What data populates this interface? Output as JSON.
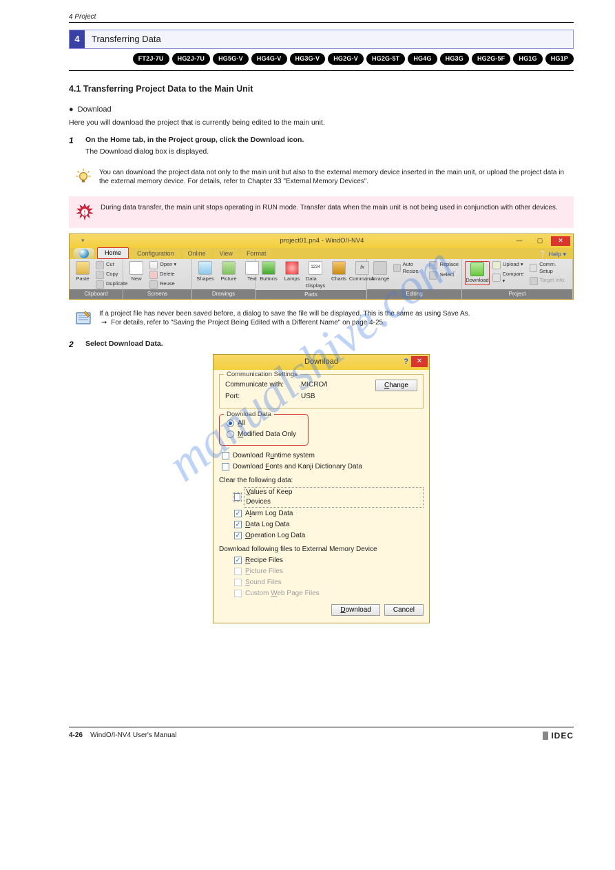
{
  "header": {
    "chapter_ref": "4   Project",
    "breadcrumb": ""
  },
  "section": {
    "number": "4",
    "title": "Transferring Data"
  },
  "models": [
    "FT2J-7U",
    "HG2J-7U",
    "HG5G-V",
    "HG4G-V",
    "HG3G-V",
    "HG2G-V",
    "HG2G-5T",
    "HG4G",
    "HG3G",
    "HG2G-5F",
    "HG1G",
    "HG1P"
  ],
  "subheading_4_1": "4.1   Transferring Project Data to the Main Unit",
  "subsub": {
    "lead": "●",
    "text": "Download"
  },
  "desc": "Here you will download the project that is currently being edited to the main unit.",
  "steps": [
    {
      "num": "1",
      "bold": "On the Home tab, in the Project group, click the Download icon.",
      "after": "The Download dialog box is displayed."
    },
    {
      "num": "2",
      "bold": "Select Download Data."
    }
  ],
  "tip": {
    "text_1": "You can download the project data not only to the main unit but also to the external memory device inserted in the main unit, or upload the project data in the external memory device. For details, refer to Chapter 33 \"External Memory Devices\"."
  },
  "warn": {
    "text": "During data transfer, the main unit stops operating in RUN mode. Transfer data when the main unit is not being used in conjunction with other devices."
  },
  "note": {
    "text_1": "If a project file has never been saved before, a dialog to save the file will be displayed. This is the same as using Save As.",
    "text_2": "For details, refer to \"Saving the Project Being Edited with a Different Name\" on page 4-25."
  },
  "ribbon": {
    "window_title": "project01.pn4 - WindO/I-NV4",
    "help": "❔ Help ▾",
    "tabs": [
      "Home",
      "Configuration",
      "Online",
      "View",
      "Format"
    ],
    "groups": {
      "clipboard": {
        "label": "Clipboard",
        "paste": "Paste",
        "cut": "Cut",
        "copy": "Copy",
        "dup": "Duplicate"
      },
      "screens": {
        "label": "Screens",
        "new": "New",
        "open": "Open ▾",
        "delete": "Delete",
        "reuse": "Reuse"
      },
      "drawings": {
        "label": "Drawings",
        "shapes": "Shapes",
        "picture": "Picture",
        "text": "Text"
      },
      "parts": {
        "label": "Parts",
        "buttons": "Buttons",
        "lamps": "Lamps",
        "data": "Data\nDisplays",
        "charts": "Charts",
        "commands": "Commands"
      },
      "editing": {
        "label": "Editing",
        "arrange": "Arrange",
        "autoresize": "Auto Resize",
        "select": "Select",
        "replace": "Replace"
      },
      "project": {
        "label": "Project",
        "download": "Download",
        "upload": "Upload ▾",
        "compare": "Compare ▾",
        "comm": "Comm. Setup",
        "target": "Target Info."
      }
    }
  },
  "dialog": {
    "title": "Download",
    "comm_legend": "Communication Settings",
    "comm_with_label": "Communicate with:",
    "comm_with_val": "MICRO/I",
    "port_label": "Port:",
    "port_val": "USB",
    "change_btn": "Change",
    "dl_legend": "Download Data",
    "opt_all": "All",
    "opt_modified": "Modified Data Only",
    "chk_runtime": "Download Runtime system",
    "chk_fonts": "Download Fonts and Kanji Dictionary Data",
    "clear_label": "Clear the following data:",
    "chk_keep": "Values of Keep Devices",
    "chk_alarm": "Alarm Log Data",
    "chk_data": "Data Log Data",
    "chk_op": "Operation Log Data",
    "ext_label": "Download following files to External Memory Device",
    "chk_recipe": "Recipe Files",
    "chk_picture": "Picture Files",
    "chk_sound": "Sound Files",
    "chk_web": "Custom Web Page Files",
    "btn_download": "Download",
    "btn_cancel": "Cancel"
  },
  "footer": {
    "page": "4-26",
    "manual": "WindO/I-NV4 User's Manual",
    "brand": "IDEC"
  },
  "watermark": "manualshive.com"
}
